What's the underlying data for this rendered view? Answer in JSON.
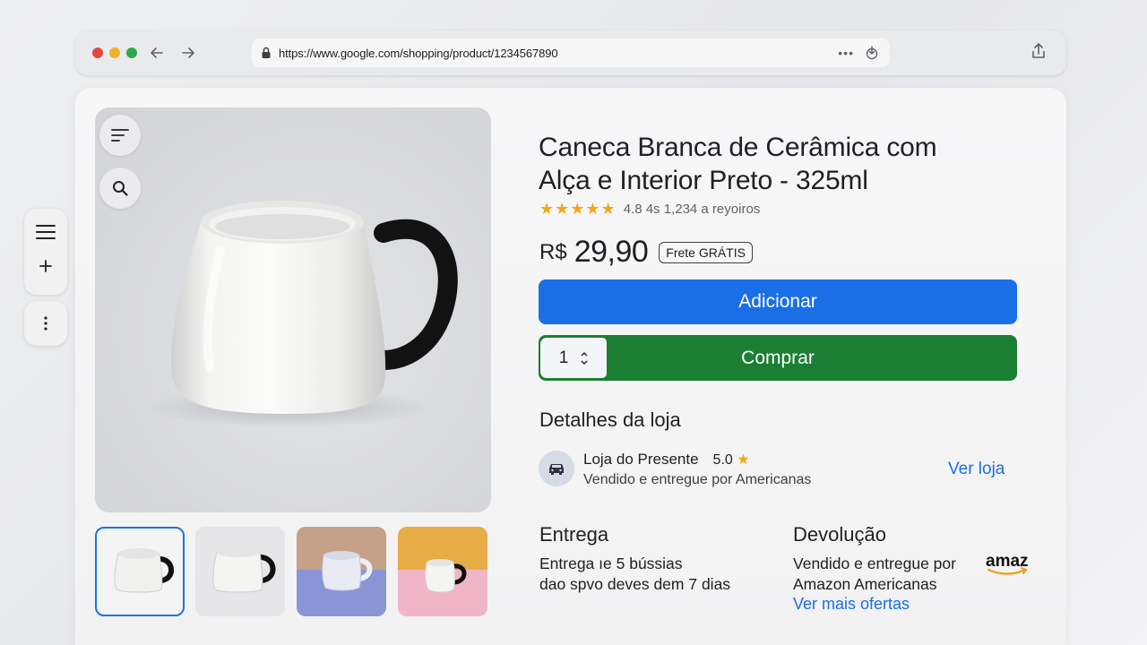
{
  "browser": {
    "url": "https://www.google.com/shopping/product/1234567890"
  },
  "product": {
    "title_line1": "Caneca Branca de Cerâmica com",
    "title_line2": "Alça e Interior Preto - 325ml",
    "stars": "★★★★★",
    "rating_text": "4.8 4s 1,234 a reyoiros",
    "currency": "R$",
    "price": "29,90",
    "shipping_badge": "Frete GRÁTIS",
    "quantity": "1"
  },
  "actions": {
    "add_label": "Adicionar",
    "buy_label": "Comprar"
  },
  "store": {
    "section_title": "Detalhes da loja",
    "name": "Loja do Presente",
    "rating": "5.0",
    "star": "★",
    "sold_by": "Vendido e entregue por Americanas",
    "link": "Ver loja",
    "icon": "car-icon"
  },
  "delivery": {
    "title": "Entrega",
    "line1": "Entrega ıe 5 bússias",
    "line2": "dao spvo deves dem 7 dias"
  },
  "returns": {
    "title": "Devolução",
    "line1": "Vendido e entregue por",
    "line2": "Amazon Americanas",
    "link": "Ver mais ofertas",
    "logo_text": "amaz"
  },
  "colors": {
    "primary_blue": "#1a6fe6",
    "buy_green": "#1b7f33",
    "star_gold": "#f2a71b",
    "thumb_selected": "#1a73e8"
  },
  "icons": [
    "back-icon",
    "forward-icon",
    "lock-icon",
    "more-icon",
    "download-icon",
    "share-icon",
    "menu-icon",
    "plus-icon",
    "more-vertical-icon",
    "filter-icon",
    "search-icon"
  ]
}
